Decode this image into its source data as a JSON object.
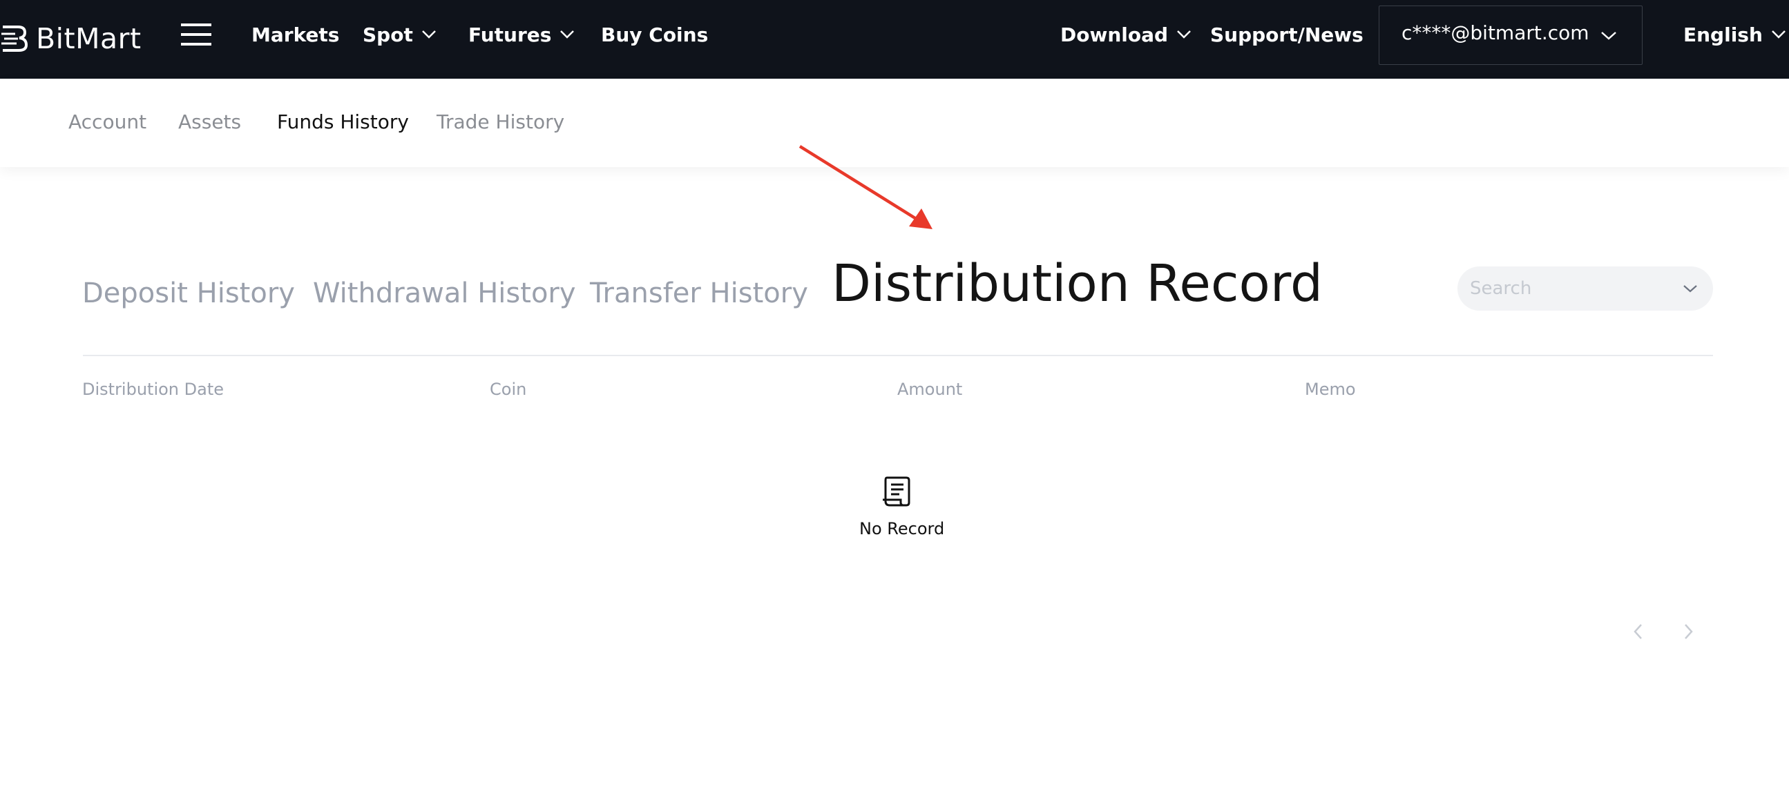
{
  "brand": {
    "name": "BitMart"
  },
  "topnav": {
    "items": [
      {
        "label": "Markets"
      },
      {
        "label": "Spot"
      },
      {
        "label": "Futures"
      },
      {
        "label": "Buy Coins"
      },
      {
        "label": "Download"
      },
      {
        "label": "Support/News"
      }
    ],
    "account_email": "c****@bitmart.com",
    "language": "English"
  },
  "subnav": {
    "items": [
      {
        "label": "Account"
      },
      {
        "label": "Assets"
      },
      {
        "label": "Funds History",
        "active": true
      },
      {
        "label": "Trade History"
      }
    ]
  },
  "history_tabs": [
    {
      "label": "Deposit History"
    },
    {
      "label": "Withdrawal History"
    },
    {
      "label": "Transfer History"
    },
    {
      "label": "Distribution Record",
      "active": true
    }
  ],
  "search": {
    "placeholder": "Search"
  },
  "table": {
    "columns": [
      "Distribution Date",
      "Coin",
      "Amount",
      "Memo"
    ],
    "empty_text": "No Record"
  },
  "colors": {
    "navbar_bg": "#0f131b",
    "active_text": "#141414",
    "inactive_tab": "#9aa0ac",
    "annotation_arrow": "#e8392a"
  }
}
